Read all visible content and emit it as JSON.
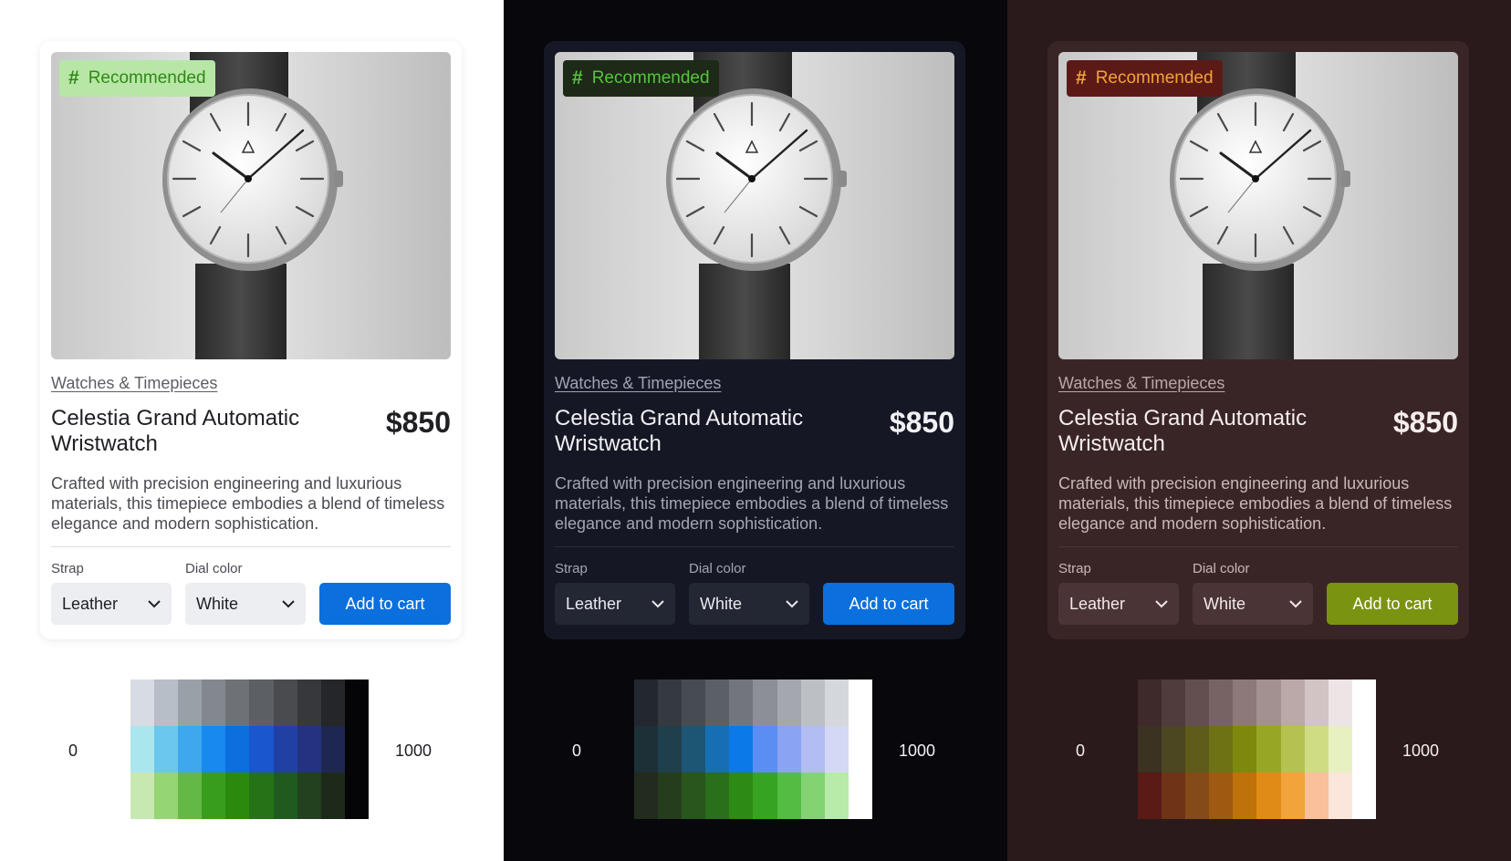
{
  "themes": [
    {
      "key": "light",
      "badge": {
        "icon": "#",
        "label": "Recommended"
      },
      "category": "Watches & Timepieces",
      "title": "Celestia Grand Automatic Wristwatch",
      "price": "$850",
      "description": "Crafted with precision engineering and luxurious materials, this timepiece embodies a blend of timeless elegance and modern sophistication.",
      "strap": {
        "label": "Strap",
        "value": "Leather"
      },
      "dial": {
        "label": "Dial color",
        "value": "White"
      },
      "cta": {
        "label": "Add to cart",
        "color": "#0b6fde"
      },
      "scale": {
        "min_label": "0",
        "max_label": "1000",
        "rows": [
          [
            "#d7dbe3",
            "#b8bec7",
            "#9aa0a7",
            "#83888e",
            "#6e7276",
            "#5c5f63",
            "#494b4f",
            "#36383b",
            "#24262a",
            "#050507"
          ],
          [
            "#a9e6ee",
            "#6bc7ee",
            "#3da8ee",
            "#1889ee",
            "#0b6fde",
            "#1a56cd",
            "#2140a4",
            "#233381",
            "#1d2752",
            "#050507"
          ],
          [
            "#c8e8b2",
            "#95d574",
            "#64b845",
            "#389d1c",
            "#2b8a0d",
            "#247317",
            "#215a1f",
            "#23401f",
            "#1d2a1a",
            "#050507"
          ]
        ]
      }
    },
    {
      "key": "dark",
      "badge": {
        "icon": "#",
        "label": "Recommended"
      },
      "category": "Watches & Timepieces",
      "title": "Celestia Grand Automatic Wristwatch",
      "price": "$850",
      "description": "Crafted with precision engineering and luxurious materials, this timepiece embodies a blend of timeless elegance and modern sophistication.",
      "strap": {
        "label": "Strap",
        "value": "Leather"
      },
      "dial": {
        "label": "Dial color",
        "value": "White"
      },
      "cta": {
        "label": "Add to cart",
        "color": "#0b6fde"
      },
      "scale": {
        "min_label": "0",
        "max_label": "1000",
        "rows": [
          [
            "#23272f",
            "#353940",
            "#474b52",
            "#5b5f66",
            "#72767c",
            "#8c9096",
            "#a4a8ae",
            "#bcc0c5",
            "#d4d7db",
            "#ffffff"
          ],
          [
            "#1e3037",
            "#203f4c",
            "#1d5575",
            "#166fb4",
            "#0b7ae8",
            "#5a8ef3",
            "#8aa3f2",
            "#b2bdf3",
            "#d4d8f5",
            "#ffffff"
          ],
          [
            "#232b1f",
            "#263d1d",
            "#28561d",
            "#2a6f19",
            "#2d8a14",
            "#36a422",
            "#54bc43",
            "#83d372",
            "#b8ebaa",
            "#ffffff"
          ]
        ]
      }
    },
    {
      "key": "warm",
      "badge": {
        "icon": "#",
        "label": "Recommended"
      },
      "category": "Watches & Timepieces",
      "title": "Celestia Grand Automatic Wristwatch",
      "price": "$850",
      "description": "Crafted with precision engineering and luxurious materials, this timepiece embodies a blend of timeless elegance and modern sophistication.",
      "strap": {
        "label": "Strap",
        "value": "Leather"
      },
      "dial": {
        "label": "Dial color",
        "value": "White"
      },
      "cta": {
        "label": "Add to cart",
        "color": "#7a9310"
      },
      "scale": {
        "min_label": "0",
        "max_label": "1000",
        "rows": [
          [
            "#3e2a2b",
            "#513c3d",
            "#644f50",
            "#786364",
            "#8d797a",
            "#a39091",
            "#bba9aa",
            "#d2c4c5",
            "#ede5e5",
            "#ffffff"
          ],
          [
            "#3b3222",
            "#4c4720",
            "#5e5b1b",
            "#6e7114",
            "#7d890c",
            "#98a625",
            "#b5c251",
            "#cfdc83",
            "#e7f0c1",
            "#ffffff"
          ],
          [
            "#5a1a16",
            "#6e3417",
            "#844a17",
            "#9e5a10",
            "#bf710a",
            "#e08b18",
            "#f2a33a",
            "#f8c09b",
            "#fae6da",
            "#ffffff"
          ]
        ]
      }
    }
  ]
}
